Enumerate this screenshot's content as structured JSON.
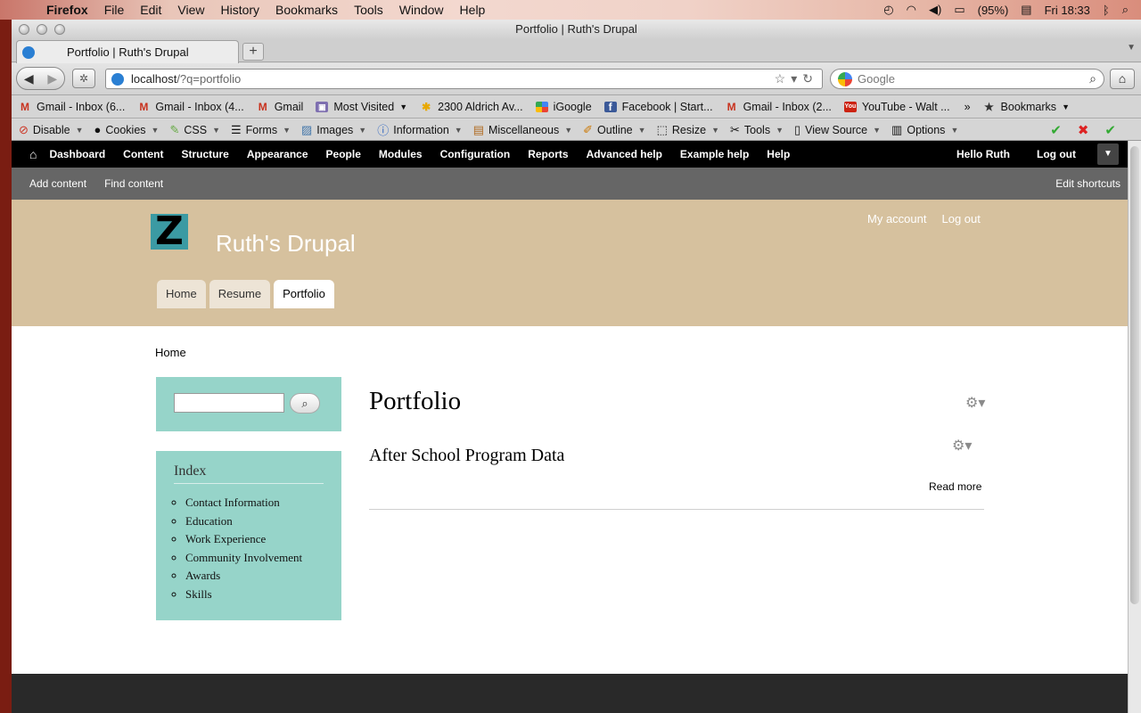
{
  "menubar": {
    "app": "Firefox",
    "items": [
      "File",
      "Edit",
      "View",
      "History",
      "Bookmarks",
      "Tools",
      "Window",
      "Help"
    ],
    "battery": "(95%)",
    "clock": "Fri 18:33"
  },
  "window": {
    "title": "Portfolio | Ruth's Drupal"
  },
  "tab": {
    "label": "Portfolio | Ruth's Drupal",
    "new_tab": "+"
  },
  "nav": {
    "url_host": "localhost",
    "url_path": "/?q=portfolio",
    "search_placeholder": "Google"
  },
  "bookmarks": [
    "Gmail - Inbox (6...",
    "Gmail - Inbox (4...",
    "Gmail",
    "Most Visited",
    "2300 Aldrich Av...",
    "iGoogle",
    "Facebook | Start...",
    "Gmail - Inbox (2...",
    "YouTube - Walt ...",
    "Bookmarks"
  ],
  "devbar": [
    "Disable",
    "Cookies",
    "CSS",
    "Forms",
    "Images",
    "Information",
    "Miscellaneous",
    "Outline",
    "Resize",
    "Tools",
    "View Source",
    "Options"
  ],
  "admin": {
    "menu": [
      "Dashboard",
      "Content",
      "Structure",
      "Appearance",
      "People",
      "Modules",
      "Configuration",
      "Reports",
      "Advanced help",
      "Example help",
      "Help"
    ],
    "hello": "Hello Ruth",
    "logout": "Log out"
  },
  "shortcuts": {
    "items": [
      "Add content",
      "Find content"
    ],
    "edit": "Edit shortcuts"
  },
  "site": {
    "logo_letter": "Z",
    "name": "Ruth's Drupal",
    "secondary": [
      "My account",
      "Log out"
    ],
    "tabs": [
      "Home",
      "Resume",
      "Portfolio"
    ],
    "active_tab": "Portfolio"
  },
  "breadcrumb": "Home",
  "sidebar": {
    "index_title": "Index",
    "index_items": [
      "Contact Information",
      "Education",
      "Work Experience",
      "Community Involvement",
      "Awards",
      "Skills"
    ]
  },
  "main": {
    "title": "Portfolio",
    "node_title": "After School Program Data",
    "read_more": "Read more"
  }
}
